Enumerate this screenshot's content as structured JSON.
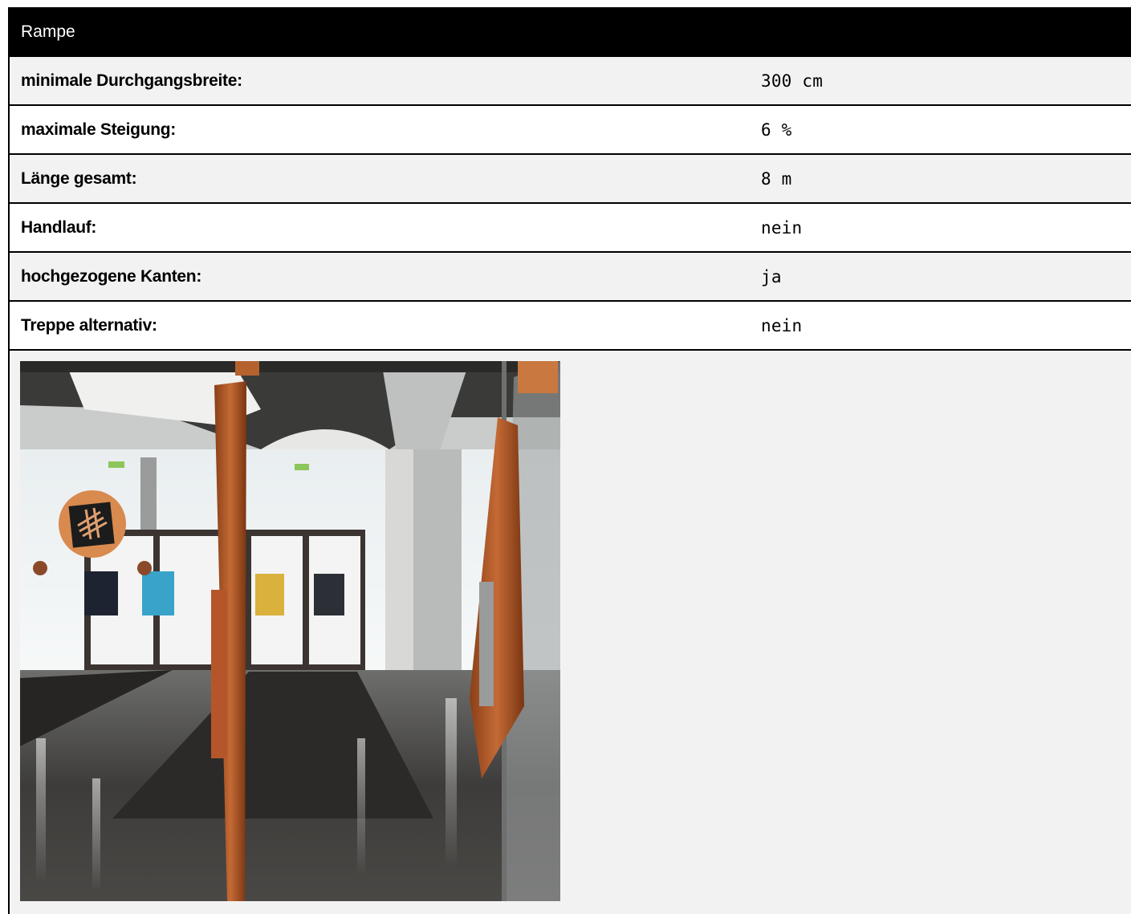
{
  "header": {
    "title": "Rampe"
  },
  "rows": [
    {
      "label": "minimale Durchgangsbreite:",
      "value": "300 cm"
    },
    {
      "label": "maximale Steigung:",
      "value": "6 %"
    },
    {
      "label": "Länge gesamt:",
      "value": "8 m"
    },
    {
      "label": "Handlauf:",
      "value": "nein"
    },
    {
      "label": "hochgezogene Kanten:",
      "value": "ja"
    },
    {
      "label": "Treppe alternativ:",
      "value": "nein"
    }
  ],
  "colors": {
    "header_bg": "#000000",
    "stripe": "#f2f2f2",
    "accent_orange": "#c8662a"
  },
  "photo": {
    "subject": "entrance-lobby-photo"
  }
}
